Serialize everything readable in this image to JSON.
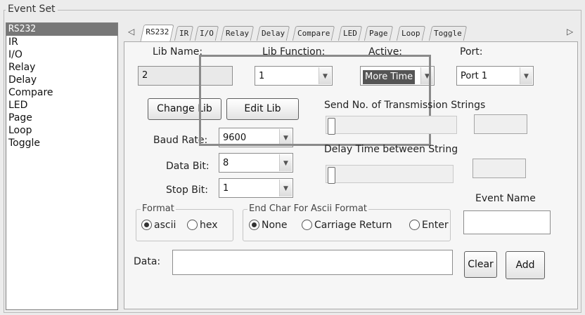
{
  "groupbox": {
    "title": "Event Set"
  },
  "event_list": [
    "RS232",
    "IR",
    "I/O",
    "Relay",
    "Delay",
    "Compare",
    "LED",
    "Page",
    "Loop",
    "Toggle"
  ],
  "tabs": [
    "RS232",
    "IR",
    "I/O",
    "Relay",
    "Delay",
    "Compare",
    "LED",
    "Page",
    "Loop",
    "Toggle"
  ],
  "tab_arrows": {
    "left": "◁",
    "right": "▷"
  },
  "form": {
    "lib_name_label": "Lib Name:",
    "lib_name_value": "2",
    "lib_function_label": "Lib Function:",
    "lib_function_value": "1",
    "active_label": "Active:",
    "active_value": "More Time",
    "port_label": "Port:",
    "port_value": "Port 1",
    "change_lib": "Change Lib",
    "edit_lib": "Edit Lib",
    "baud_rate_label": "Baud Rate:",
    "baud_rate_value": "9600",
    "data_bit_label": "Data Bit:",
    "data_bit_value": "8",
    "stop_bit_label": "Stop Bit:",
    "stop_bit_value": "1",
    "send_label": "Send No. of Transmission Strings",
    "send_slider_level": 0,
    "send_value": "",
    "delay_label": "Delay Time between String",
    "delay_slider_level": 0,
    "delay_value": "",
    "format_legend": "Format",
    "format_options": [
      "ascii",
      "hex"
    ],
    "format_selected": "ascii",
    "endchar_legend": "End Char For Ascii Format",
    "endchar_options": [
      "None",
      "Carriage Return",
      "Enter"
    ],
    "endchar_selected": "None",
    "event_name_label": "Event Name",
    "event_name_value": "",
    "data_label": "Data:",
    "data_value": "",
    "clear": "Clear",
    "add": "Add"
  },
  "icons": {
    "dropdown": "chevron-down-icon"
  },
  "colors": {
    "selected_row": "#777777",
    "highlight_box": "#8a8a8a"
  }
}
